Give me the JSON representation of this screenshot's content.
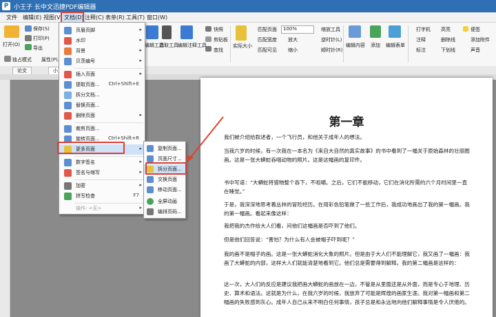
{
  "titlebar": {
    "title": "小王子 长中文迅捷PDF编辑器"
  },
  "menubar": {
    "items": [
      "文件",
      "编辑(E)",
      "视图(V)",
      "文档(D)",
      "注释(C)",
      "表单(R)",
      "工具(T)",
      "窗口(W)"
    ]
  },
  "ribbon": {
    "open": "打开(O)",
    "save": "保存(S)",
    "print": "打印(P)",
    "export": "导出",
    "standalone": "独占模式",
    "properties": "属性(P)...",
    "edit_tool": "编辑工具",
    "select_tool": "选取工具",
    "annot_tool": "编辑注释工具",
    "snapshot": "快照",
    "clipboard": "剪贴板",
    "find": "查找",
    "actual_size": "实际大小",
    "fit_page": "匹配页面",
    "fit_width": "匹配宽度",
    "fit_visible": "匹配可见",
    "zoom_value": "100%",
    "zoom_in": "放大",
    "zoom_out": "缩小",
    "zoom_tool": "缩放工具",
    "rotate_left": "逆时针(L)",
    "rotate_right": "顺时针(R)",
    "edit_content": "编辑内容",
    "add": "添加",
    "edit_form": "编辑表单",
    "typewriter": "打字机",
    "note": "注释",
    "mark": "标注",
    "highlight": "高亮",
    "strikeout": "删除线",
    "underline": "下划线",
    "sticky": "便签",
    "add_attach": "添加附件",
    "sound": "声音"
  },
  "tabs": [
    "论文",
    "小王子"
  ],
  "doc_menu": {
    "items": [
      {
        "label": "页眉页脚",
        "arrow": "▸",
        "shortcut": ""
      },
      {
        "label": "水印",
        "arrow": "▸",
        "shortcut": ""
      },
      {
        "label": "背景",
        "arrow": "▸",
        "shortcut": ""
      },
      {
        "label": "贝茨编号",
        "arrow": "▸",
        "shortcut": ""
      },
      {
        "label": "插入页面",
        "arrow": "▸",
        "shortcut": ""
      },
      {
        "label": "提取页面...",
        "arrow": "",
        "shortcut": "Ctrl+Shift+E"
      },
      {
        "label": "拆分文档...",
        "arrow": "",
        "shortcut": ""
      },
      {
        "label": "替换页面...",
        "arrow": "",
        "shortcut": ""
      },
      {
        "label": "删除页面",
        "arrow": "▸",
        "shortcut": ""
      },
      {
        "label": "裁剪页面...",
        "arrow": "",
        "shortcut": ""
      },
      {
        "label": "旋转页面...",
        "arrow": "",
        "shortcut": "Ctrl+Shift+R"
      },
      {
        "label": "更多页面",
        "arrow": "▸",
        "shortcut": ""
      },
      {
        "label": "数字签名",
        "arrow": "▸",
        "shortcut": ""
      },
      {
        "label": "签名与缩写",
        "arrow": "▸",
        "shortcut": ""
      },
      {
        "label": "加密",
        "arrow": "▸",
        "shortcut": ""
      },
      {
        "label": "拼写检查",
        "arrow": "",
        "shortcut": "F7"
      },
      {
        "label": "操作: <无>",
        "arrow": "▸",
        "shortcut": ""
      }
    ]
  },
  "sub_menu": {
    "items": [
      "复制页面...",
      "页面尺寸...",
      "拆分页面...",
      "交换页面",
      "移动页面...",
      "全屏动画",
      "编排页码..."
    ]
  },
  "page": {
    "heading": "第一章",
    "paragraphs": [
      "我们被介绍给叙述者，一个飞行员，和他关于成年人的想法。",
      "当我六岁的时候，有一次我在一本名为《来自大自然的真实故事》的书中看到了一幅关于原始森林的壮丽图画。这是一张大蟒蛇吞咽动物的照片。这是这幅画的复印件。",
      "书中写道：“大蟒蛇将猎物整个吞下，不咀嚼。之后，它们不能移动，它们在消化所需的六个月时间里一直在睡觉。”",
      "于是，我深深地思考着丛林的冒险经历。在用彩色铅笔做了一些工作后，我成功地画出了我的第一幅画。我的第一幅画。看起来像这样：",
      "我把我的杰作给大人们看，问他们这幅画是否吓到了他们。",
      "但是他们回答说：“害怕？为什么有人会被帽子吓到呢？”",
      "我的画不是帽子的画。这是一张大蟒蛇消化大象的照片。但是由于大人们不能理解它，我又画了一幅画：我画了大蟒蛇的内部，这样大人们就能清楚地看到它。他们总是需要得到解释。我的第二幅画是这样的：",
      "这一次，大人们的反应是建议我把画大蟒蛇的画放在一边，不管是从里面还是从外面，而是专心于地理、历史、算术和语法。这就是为什么，在我六岁的时候，我放弃了可能是辉煌的画家生涯。我对第一幅画和第二幅画的失败感到灰心。成年人自己从来不明白任何事情，孩子总是和永远地向他们解释事情是令人厌倦的。"
    ]
  },
  "colors": {
    "titlebar": "#2f6fb3",
    "highlight_box": "#e03b2c",
    "arrow": "#d9452f"
  }
}
